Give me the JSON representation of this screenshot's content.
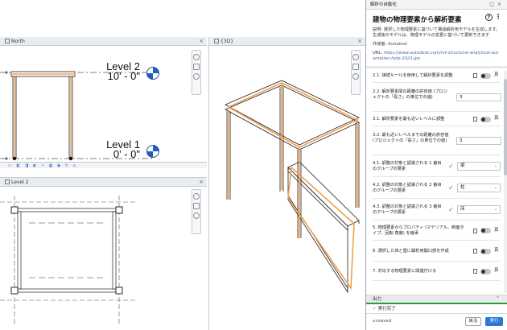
{
  "views": {
    "north": {
      "tab_label": "North",
      "levels": [
        {
          "name": "Level 2",
          "elevation": "10' - 0\""
        },
        {
          "name": "Level 1",
          "elevation": "0' - 0\""
        }
      ]
    },
    "level2": {
      "tab_label": "Level 2"
    },
    "view3d": {
      "tab_label": "{3D}"
    }
  },
  "panel": {
    "window_title": "解析の自動化",
    "title": "建物の物理要素から解析要素",
    "description": "説明: 選択した物理要素に基づいて構造解析用モデルを生成します。生成後のモデルは、物理モデルの変更に基づいて更新できます",
    "author_label": "作成者:",
    "author": "Autodesk",
    "url_label": "URL:",
    "url": "https://www.autodesk.com/rvt-structural-analytical-automation-help-2023-jpn",
    "rows": [
      {
        "label": "2.1. 接続ルールを使用して解析要素を調整",
        "control": "toggle",
        "value": "真"
      },
      {
        "label": "2.2. 解析要素間の距離の許容値 (プロジェクトの「長さ」の単位での値)",
        "control": "number",
        "value": "3"
      },
      {
        "label": "3.1. 解析要素を最も近いレベルに調整",
        "control": "toggle",
        "value": "真"
      },
      {
        "label": "3.2. 最も近いレベルまでの距離の許容値 (プロジェクトの「長さ」の単位での値)",
        "control": "number",
        "value": "3"
      },
      {
        "label": "4.1. 調整の対象と認識される 1 番目のグループの要素",
        "control": "select",
        "value": "梁"
      },
      {
        "label": "4.2. 調整の対象と認識される 2 番目のグループの要素",
        "control": "select",
        "value": "柱"
      },
      {
        "label": "4.3. 調整の対象と認識される 3 番目のグループの要素",
        "control": "select",
        "value": "床"
      },
      {
        "label": "5. 物理要素からプロパティ (マテリアル、断面タイプ、回転 角度) を継承",
        "control": "toggle",
        "value": "真"
      },
      {
        "label": "6. 選択した床と壁に解析用開口部を作成",
        "control": "toggle",
        "value": "真"
      },
      {
        "label": "7. 対応する物理要素に関連付ける",
        "control": "toggle",
        "value": "真"
      }
    ],
    "output_label": "出力",
    "output_message": "実行完了",
    "status": "unsaved",
    "back_label": "戻る",
    "run_label": "実行",
    "colors": {
      "accent": "#2a77d6",
      "success": "#2e9b3a",
      "analytical": "#f0a050"
    }
  }
}
